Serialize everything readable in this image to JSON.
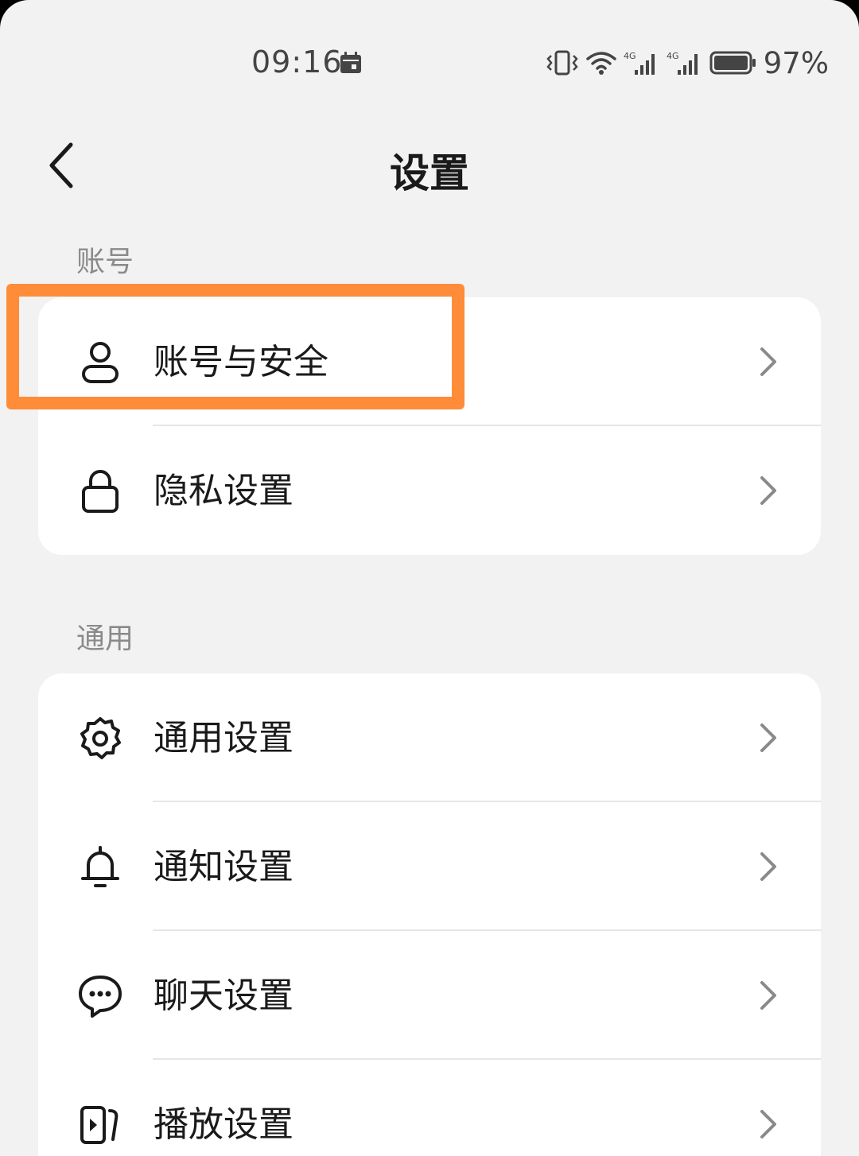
{
  "status_bar": {
    "time": "09:16",
    "battery_percent": "97%",
    "network_1": "4G",
    "network_2": "4G"
  },
  "header": {
    "title": "设置"
  },
  "sections": [
    {
      "label": "账号",
      "items": [
        {
          "label": "账号与安全",
          "icon": "person-icon"
        },
        {
          "label": "隐私设置",
          "icon": "lock-icon"
        }
      ]
    },
    {
      "label": "通用",
      "items": [
        {
          "label": "通用设置",
          "icon": "gear-icon"
        },
        {
          "label": "通知设置",
          "icon": "bell-icon"
        },
        {
          "label": "聊天设置",
          "icon": "chat-bubble-icon"
        },
        {
          "label": "播放设置",
          "icon": "play-icon"
        }
      ]
    }
  ],
  "highlight": {
    "target": "账号与安全",
    "color": "#ff8c38"
  }
}
